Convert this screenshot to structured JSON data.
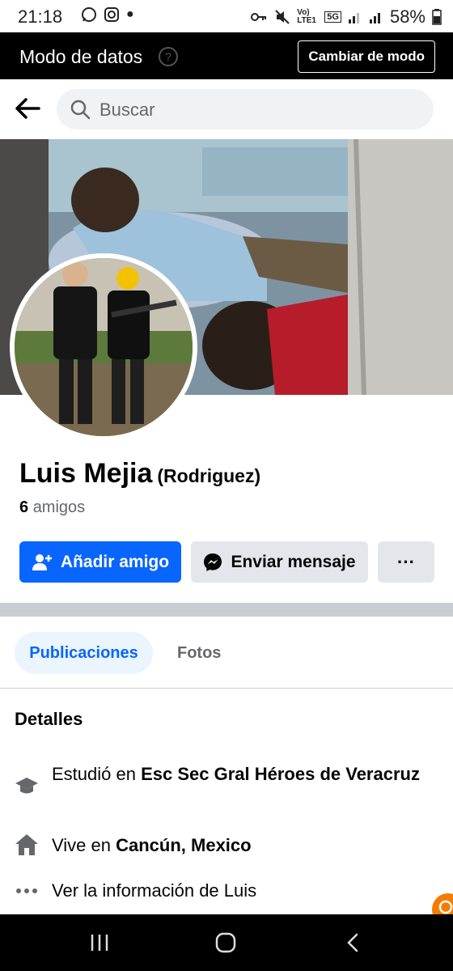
{
  "status_bar": {
    "time": "21:18",
    "battery": "58%",
    "network": "5G",
    "volte": "Vo) LTE1"
  },
  "data_mode": {
    "title": "Modo de datos",
    "button": "Cambiar de modo"
  },
  "search": {
    "placeholder": "Buscar"
  },
  "profile": {
    "name": "Luis Mejia",
    "alt_name": "(Rodriguez)",
    "friends_count": "6",
    "friends_label": "amigos"
  },
  "actions": {
    "add_friend": "Añadir amigo",
    "send_message": "Enviar mensaje",
    "more": "···"
  },
  "tabs": [
    {
      "label": "Publicaciones",
      "active": true
    },
    {
      "label": "Fotos",
      "active": false
    }
  ],
  "details": {
    "heading": "Detalles",
    "studied_prefix": "Estudió en",
    "studied_place": "Esc Sec Gral Héroes de Veracruz",
    "lives_prefix": "Vive en",
    "lives_place": "Cancún, Mexico",
    "see_info": "Ver la información de Luis"
  },
  "colors": {
    "accent": "#0866ff",
    "secondary_button": "#e4e6eb",
    "divider": "#c9ccd1"
  }
}
